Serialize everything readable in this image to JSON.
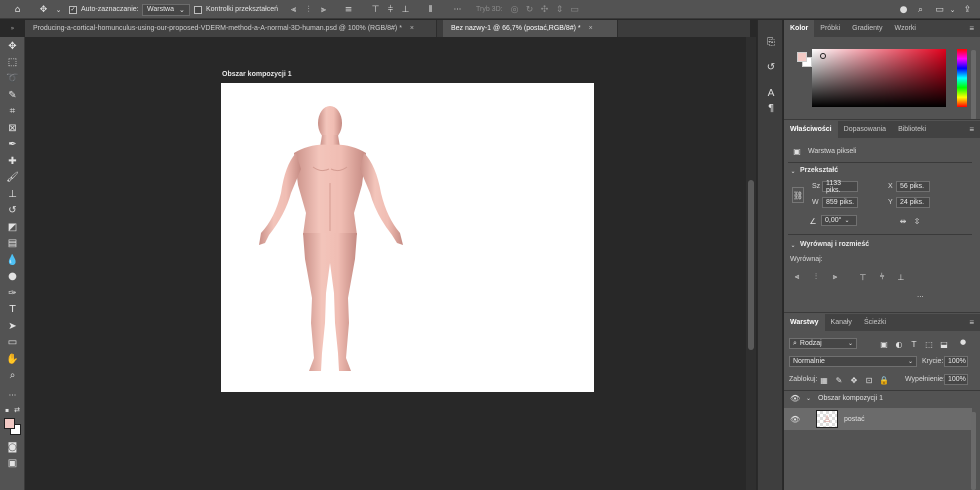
{
  "options_bar": {
    "home_icon": "home-icon",
    "move_icon": "move-tool-icon",
    "auto_select_label": "Auto-zaznaczanie:",
    "auto_select_checked": true,
    "auto_select_target": "Warstwa",
    "transform_controls_label": "Kontrolki przekształceń",
    "mode_3d_label": "Tryb 3D:"
  },
  "tabs": [
    {
      "label": "Producing-a-cortical-homunculus-using-our-proposed-VDERM-method-a-A-normal-3D-human.psd @ 100% (RGB/8#) *",
      "close": "×"
    },
    {
      "label": "Bez nazwy-1 @ 66,7% (postać,RGB/8#) *",
      "close": "×"
    }
  ],
  "canvas": {
    "artboard_title": "Obszar kompozycji 1",
    "background": "#ffffff",
    "figure_color": "#f0bdb3"
  },
  "color_panel": {
    "tabs": [
      "Kolor",
      "Próbki",
      "Gradienty",
      "Wzorki"
    ],
    "active_tab": "Kolor",
    "hue_color": "#e1001c",
    "foreground": "#f2c9c4",
    "background_swatch": "#ffffff"
  },
  "properties_panel": {
    "tabs": [
      "Właściwości",
      "Dopasowania",
      "Biblioteki"
    ],
    "active_tab": "Właściwości",
    "layer_kind": "Warstwa pikseli",
    "transform_heading": "Przekształć",
    "w_label": "Sz",
    "w_value": "1133 piks.",
    "h_label": "W",
    "h_value": "859 piks.",
    "x_label": "X",
    "x_value": "56 piks.",
    "y_label": "Y",
    "y_value": "24 piks.",
    "angle_value": "0,00°",
    "align_heading": "Wyrównaj i rozmieść",
    "align_label": "Wyrównaj:",
    "more": "..."
  },
  "layers_panel": {
    "tabs": [
      "Warstwy",
      "Kanały",
      "Ścieżki"
    ],
    "active_tab": "Warstwy",
    "filter_kind": "Rodzaj",
    "blend_mode": "Normalnie",
    "opacity_label": "Krycie:",
    "opacity_value": "100%",
    "lock_label": "Zablokuj:",
    "fill_label": "Wypełnienie:",
    "fill_value": "100%",
    "layers": [
      {
        "name": "Obszar kompozycji 1",
        "type": "artboard",
        "visible": true
      },
      {
        "name": "postać",
        "type": "pixel",
        "visible": true,
        "selected": true
      }
    ]
  }
}
